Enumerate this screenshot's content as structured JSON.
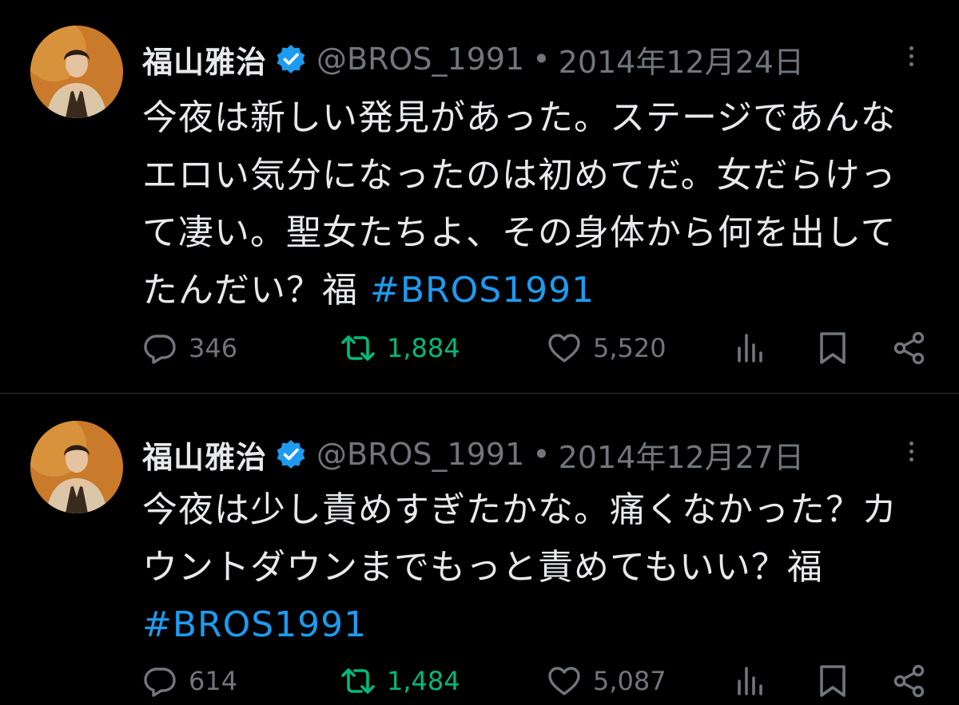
{
  "tweets": [
    {
      "author": {
        "name": "福山雅治",
        "handle": "@BROS_1991",
        "verified": true
      },
      "separator": "•",
      "date": "2014年12月24日",
      "text_lines": [
        "今夜は新しい発見があった。ステージであんな",
        "エロい気分になったのは初めてだ。女だらけっ",
        "て凄い。聖女たちよ、その身体から何を出して",
        "たんだい？福 "
      ],
      "hashtag": "#BROS1991",
      "stats": {
        "replies": "346",
        "retweets": "1,884",
        "likes": "5,520"
      }
    },
    {
      "author": {
        "name": "福山雅治",
        "handle": "@BROS_1991",
        "verified": true
      },
      "separator": "•",
      "date": "2014年12月27日",
      "text_lines": [
        "今夜は少し責めすぎたかな。痛くなかった？カ",
        "ウントダウンまでもっと責めてもいい？福"
      ],
      "hashtag": "#BROS1991",
      "stats": {
        "replies": "614",
        "retweets": "1,484",
        "likes": "5,087"
      }
    }
  ],
  "icons": {
    "reply": "reply-icon",
    "retweet": "retweet-icon",
    "like": "heart-icon",
    "views": "views-icon",
    "bookmark": "bookmark-icon",
    "share": "share-icon",
    "more": "more-icon",
    "verified": "verified-badge-icon"
  },
  "colors": {
    "background": "#000000",
    "text": "#e7e9ea",
    "secondary": "#71767b",
    "accent": "#1d9bf0",
    "retweet": "#00ba7c",
    "divider": "#2f3336"
  }
}
